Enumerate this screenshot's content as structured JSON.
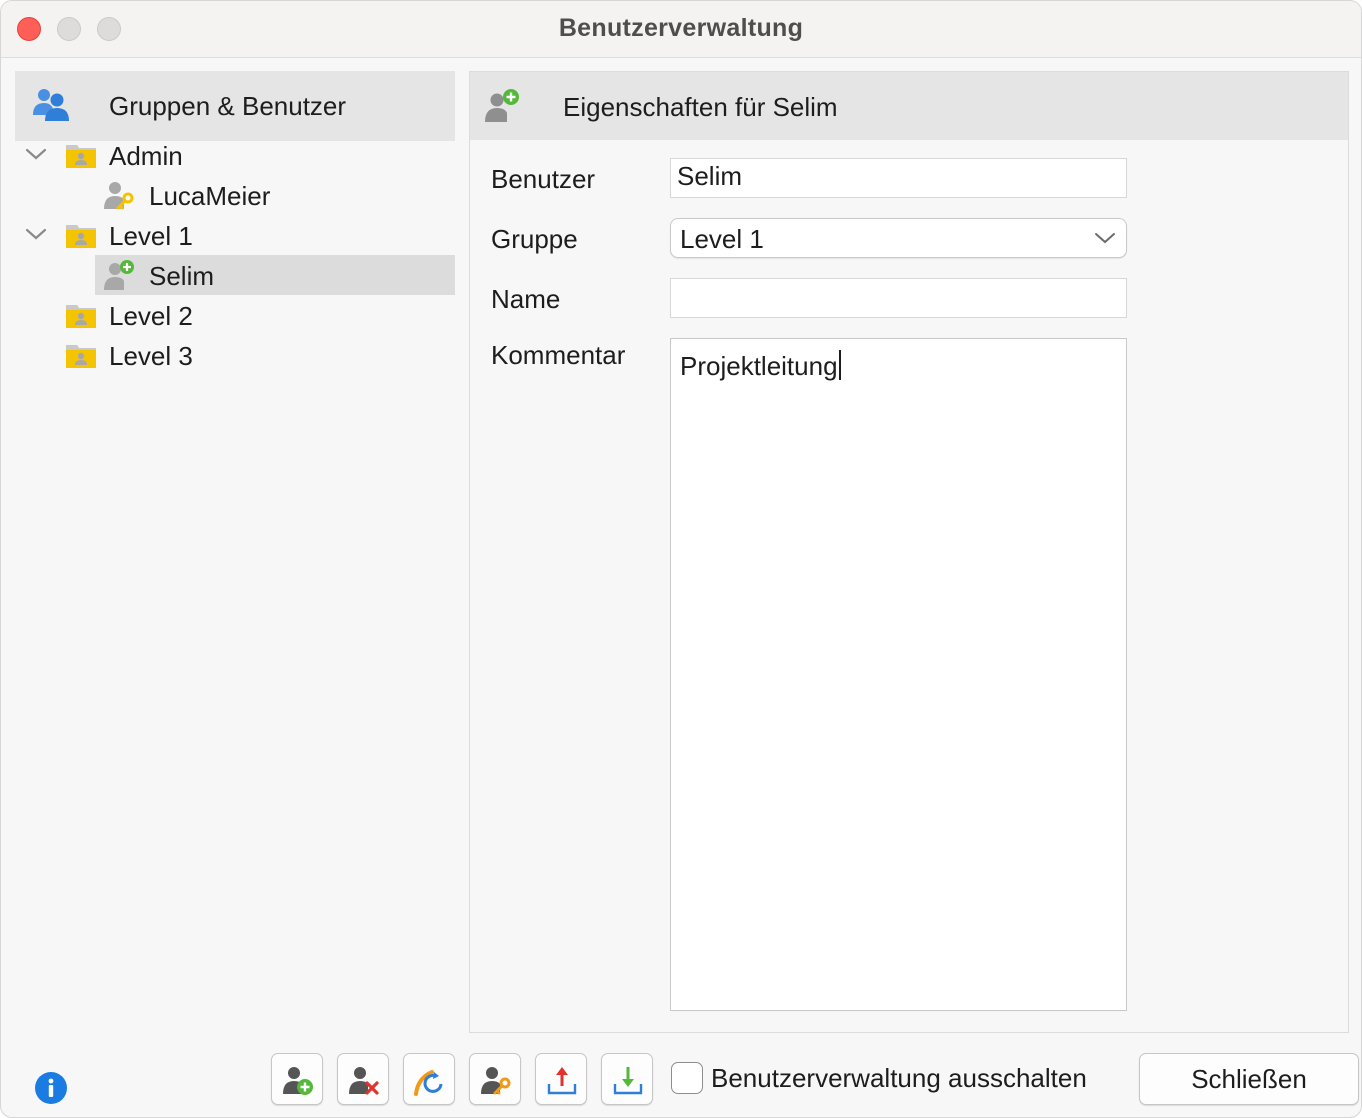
{
  "window": {
    "title": "Benutzerverwaltung"
  },
  "left_panel": {
    "header": "Gruppen & Benutzer",
    "tree": [
      {
        "label": "Admin",
        "type": "group",
        "expanded": true
      },
      {
        "label": "LucaMeier",
        "type": "user",
        "icon": "user-key-icon"
      },
      {
        "label": "Level 1",
        "type": "group",
        "expanded": true
      },
      {
        "label": "Selim",
        "type": "user",
        "icon": "user-add-icon",
        "selected": true
      },
      {
        "label": "Level 2",
        "type": "group",
        "expanded": false
      },
      {
        "label": "Level 3",
        "type": "group",
        "expanded": false
      }
    ]
  },
  "right_panel": {
    "header": "Eigenschaften für Selim",
    "form": {
      "user_label": "Benutzer",
      "user_value": "Selim",
      "group_label": "Gruppe",
      "group_value": "Level 1",
      "name_label": "Name",
      "name_value": "",
      "comment_label": "Kommentar",
      "comment_value": "Projektleitung"
    }
  },
  "bottom_bar": {
    "tools": [
      {
        "icon": "add-user-icon"
      },
      {
        "icon": "delete-user-icon"
      },
      {
        "icon": "refresh-user-icon"
      },
      {
        "icon": "user-password-icon"
      },
      {
        "icon": "export-icon"
      },
      {
        "icon": "import-icon"
      }
    ],
    "disable_checkbox_label": "Benutzerverwaltung ausschalten",
    "disable_checked": false,
    "close_label": "Schließen"
  },
  "colors": {
    "folder": "#f5c400",
    "accent_blue": "#2f7fd8",
    "add_green": "#54b83a",
    "delete_red": "#e0332d",
    "key_orange": "#f09a1a"
  }
}
